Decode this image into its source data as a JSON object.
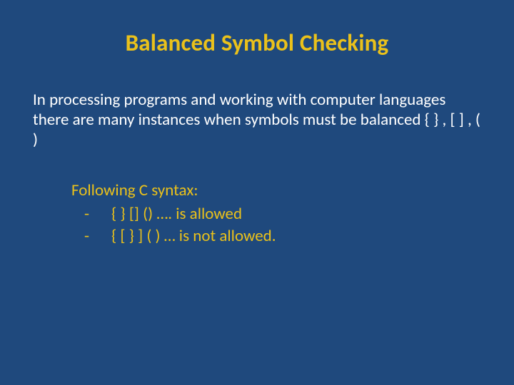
{
  "slide": {
    "title": "Balanced Symbol Checking",
    "body": "In processing programs and working with computer languages there are many instances when symbols must be balanced  { } , [ ] , ( )",
    "sub": {
      "heading": "Following C syntax:",
      "items": [
        {
          "dash": "-",
          "text": "{ } [] () …. is allowed"
        },
        {
          "dash": "-",
          "text": "{ [ } ] ( ) … is not allowed."
        }
      ]
    }
  }
}
